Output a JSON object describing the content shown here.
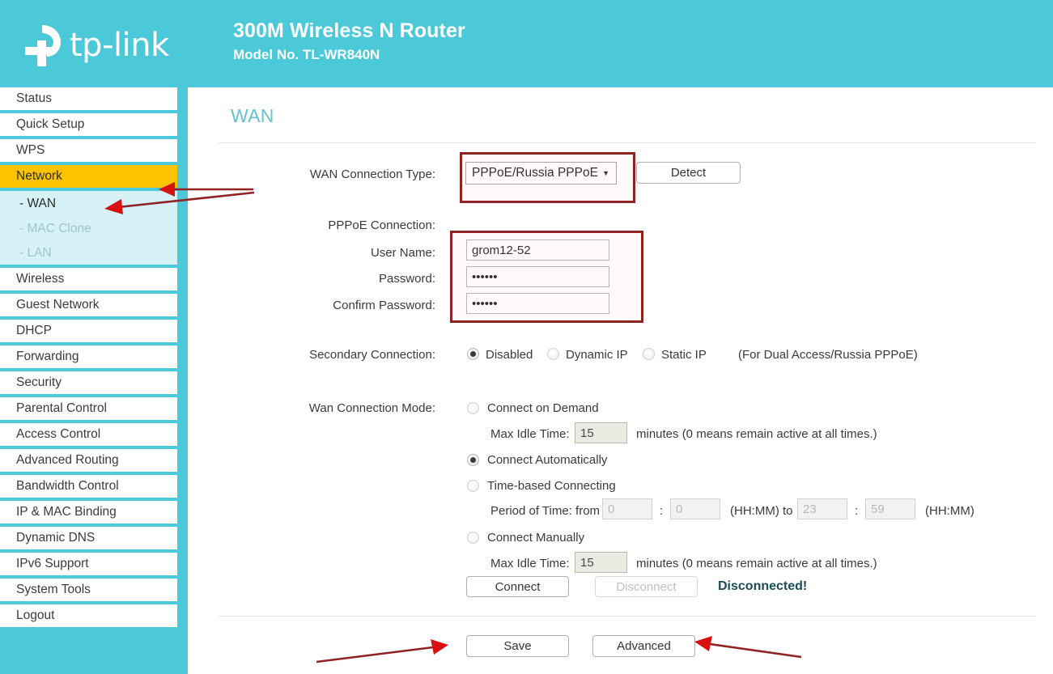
{
  "header": {
    "brand": "tp-link",
    "logo_icon": "tp-link-logo-icon",
    "product_name": "300M Wireless N Router",
    "model_no": "Model No. TL-WR840N",
    "bg_color": "#4cc9d8"
  },
  "sidebar": {
    "items": [
      {
        "label": "Status",
        "state": "normal"
      },
      {
        "label": "Quick Setup",
        "state": "normal"
      },
      {
        "label": "WPS",
        "state": "normal"
      },
      {
        "label": "Network",
        "state": "active"
      },
      {
        "label": "- WAN",
        "state": "sub-current"
      },
      {
        "label": "- MAC Clone",
        "state": "sub-dim"
      },
      {
        "label": "- LAN",
        "state": "sub-dim"
      },
      {
        "label": "Wireless",
        "state": "normal"
      },
      {
        "label": "Guest Network",
        "state": "normal"
      },
      {
        "label": "DHCP",
        "state": "normal"
      },
      {
        "label": "Forwarding",
        "state": "normal"
      },
      {
        "label": "Security",
        "state": "normal"
      },
      {
        "label": "Parental Control",
        "state": "normal"
      },
      {
        "label": "Access Control",
        "state": "normal"
      },
      {
        "label": "Advanced Routing",
        "state": "normal"
      },
      {
        "label": "Bandwidth Control",
        "state": "normal"
      },
      {
        "label": "IP & MAC Binding",
        "state": "normal"
      },
      {
        "label": "Dynamic DNS",
        "state": "normal"
      },
      {
        "label": "IPv6 Support",
        "state": "normal"
      },
      {
        "label": "System Tools",
        "state": "normal"
      },
      {
        "label": "Logout",
        "state": "normal"
      }
    ],
    "active_color": "#fdc300",
    "sub_bg_color": "#d6f2f6"
  },
  "main": {
    "title": "WAN",
    "title_color": "#64c3d2",
    "wan_connection_type": {
      "label": "WAN Connection Type:",
      "value": "PPPoE/Russia PPPoE",
      "caret": "▼",
      "detect_button": "Detect"
    },
    "pppoe": {
      "section_label": "PPPoE Connection:",
      "username_label": "User Name:",
      "username_value": "grom12-52",
      "password_label": "Password:",
      "password_value": "••••••",
      "confirm_password_label": "Confirm Password:",
      "confirm_password_value": "••••••"
    },
    "secondary_connection": {
      "label": "Secondary Connection:",
      "options": [
        {
          "label": "Disabled",
          "selected": true
        },
        {
          "label": "Dynamic IP",
          "selected": false
        },
        {
          "label": "Static IP",
          "selected": false
        }
      ],
      "note": "(For Dual Access/Russia PPPoE)"
    },
    "wan_connection_mode": {
      "label": "Wan Connection Mode:",
      "modes": [
        {
          "label": "Connect on Demand",
          "selected": false
        },
        {
          "label": "Connect Automatically",
          "selected": true
        },
        {
          "label": "Time-based Connecting",
          "selected": false
        },
        {
          "label": "Connect Manually",
          "selected": false
        }
      ],
      "max_idle_time_label": "Max Idle Time:",
      "max_idle_time_1": "15",
      "max_idle_time_2": "15",
      "minutes_note": "minutes (0 means remain active at all times.)",
      "period_label": "Period of Time: from",
      "period_from_hh": "0",
      "period_from_mm": "0",
      "period_colon": ":",
      "hhmm_note_1": "(HH:MM) to",
      "period_to_hh": "23",
      "period_to_mm": "59",
      "hhmm_note_2": "(HH:MM)",
      "connect_button": "Connect",
      "disconnect_button": "Disconnect",
      "status": "Disconnected!",
      "status_color": "#1b4d55"
    },
    "footer": {
      "save_button": "Save",
      "advanced_button": "Advanced"
    }
  },
  "annotations": {
    "color": "#8f2222",
    "arrow_color": "#cc0000",
    "boxes": [
      {
        "target": "wan-connection-type-dropdown"
      },
      {
        "target": "pppoe-credentials"
      }
    ],
    "arrows": [
      {
        "target": "sidebar-item-network"
      },
      {
        "target": "sidebar-item-wan"
      },
      {
        "target": "save-button"
      },
      {
        "target": "advanced-button"
      }
    ]
  }
}
